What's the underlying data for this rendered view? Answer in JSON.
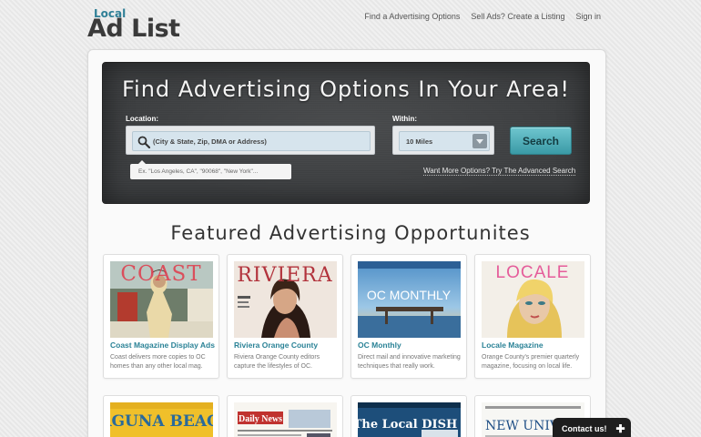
{
  "logo": {
    "small": "Local",
    "big": "Ad List"
  },
  "nav": [
    {
      "label": "Find a Advertising Options"
    },
    {
      "label": "Sell Ads? Create a Listing"
    },
    {
      "label": "Sign in"
    }
  ],
  "hero": {
    "title": "Find Advertising Options In Your Area!",
    "location_label": "Location:",
    "location_placeholder": "(City & State, Zip, DMA or Address)",
    "location_hint": "Ex. \"Los Angeles, CA\", \"90068\", \"New York\"...",
    "within_label": "Within:",
    "within_value": "10 Miles",
    "search_button": "Search",
    "advanced_link": "Want More Options? Try The Advanced Search"
  },
  "featured": {
    "title": "Featured Advertising Opportunites",
    "cards": [
      {
        "cover_text": "COAST",
        "title": "Coast Magazine Display Ads",
        "desc": "Coast delivers more copies to OC homes than any other local mag."
      },
      {
        "cover_text": "RIVIERA",
        "title": "Riviera Orange County",
        "desc": "Riviera Orange County editors capture the lifestyles of OC."
      },
      {
        "cover_text": "OC MONTHLY",
        "title": "OC Monthly",
        "desc": "Direct mail and innovative marketing techniques that really work."
      },
      {
        "cover_text": "LOCALE",
        "title": "Locale Magazine",
        "desc": "Orange County's premier quarterly magazine, focusing on local life."
      }
    ],
    "row2": [
      {
        "cover_text": "LAGUNA BEACH"
      },
      {
        "cover_text": "Daily News"
      },
      {
        "cover_text": "The Local DISH"
      },
      {
        "cover_text": "NEW UNIVE"
      }
    ]
  },
  "contact": {
    "label": "Contact us!",
    "icon": "plus-icon"
  },
  "colors": {
    "accent": "#2a8296",
    "search_button": "#4fb0bb",
    "hero_bg": "#3b3d3f"
  }
}
